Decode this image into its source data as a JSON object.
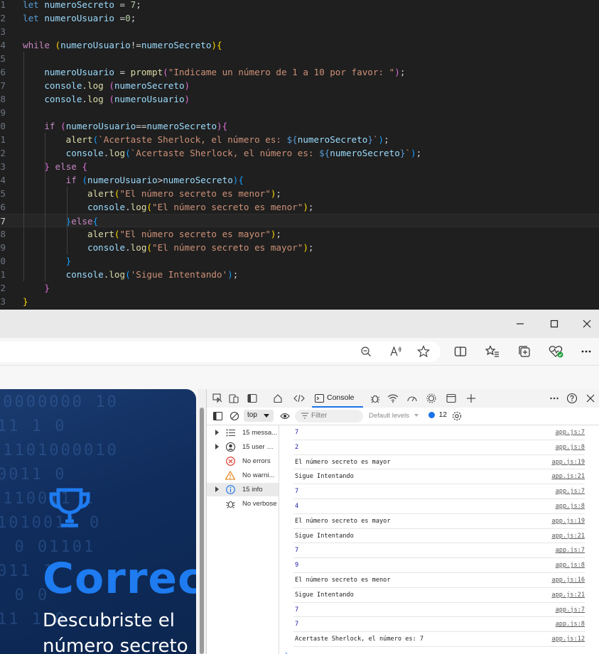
{
  "editor": {
    "lines": [
      {
        "n": "1",
        "tokens": [
          [
            "kw",
            "let"
          ],
          [
            "op",
            " "
          ],
          [
            "var",
            "numeroSecreto"
          ],
          [
            "op",
            " = "
          ],
          [
            "num",
            "7"
          ],
          [
            "op",
            ";"
          ]
        ]
      },
      {
        "n": "2",
        "tokens": [
          [
            "kw",
            "let"
          ],
          [
            "op",
            " "
          ],
          [
            "var",
            "numeroUsuario"
          ],
          [
            "op",
            " ="
          ],
          [
            "num",
            "0"
          ],
          [
            "op",
            ";"
          ]
        ]
      },
      {
        "n": "3",
        "tokens": []
      },
      {
        "n": "4",
        "tokens": [
          [
            "ctl",
            "while"
          ],
          [
            "op",
            " "
          ],
          [
            "b1",
            "("
          ],
          [
            "var",
            "numeroUsuario"
          ],
          [
            "op",
            "!="
          ],
          [
            "var",
            "numeroSecreto"
          ],
          [
            "b1",
            ")"
          ],
          [
            "b1",
            "{"
          ]
        ]
      },
      {
        "n": "5",
        "tokens": []
      },
      {
        "n": "6",
        "tokens": [
          [
            "op",
            "    "
          ],
          [
            "var",
            "numeroUsuario"
          ],
          [
            "op",
            " = "
          ],
          [
            "fn",
            "prompt"
          ],
          [
            "b2",
            "("
          ],
          [
            "str",
            "\"Indicame un número de 1 a 10 por favor: \""
          ],
          [
            "b2",
            ")"
          ],
          [
            "op",
            ";"
          ]
        ]
      },
      {
        "n": "7",
        "tokens": [
          [
            "op",
            "    "
          ],
          [
            "var",
            "console"
          ],
          [
            "op",
            "."
          ],
          [
            "fn",
            "log"
          ],
          [
            "op",
            " "
          ],
          [
            "b2",
            "("
          ],
          [
            "var",
            "numeroSecreto"
          ],
          [
            "b2",
            ")"
          ]
        ]
      },
      {
        "n": "8",
        "tokens": [
          [
            "op",
            "    "
          ],
          [
            "var",
            "console"
          ],
          [
            "op",
            "."
          ],
          [
            "fn",
            "log"
          ],
          [
            "op",
            " "
          ],
          [
            "b2",
            "("
          ],
          [
            "var",
            "numeroUsuario"
          ],
          [
            "b2",
            ")"
          ]
        ]
      },
      {
        "n": "9",
        "tokens": []
      },
      {
        "n": "0",
        "tokens": [
          [
            "op",
            "    "
          ],
          [
            "ctl",
            "if"
          ],
          [
            "op",
            " "
          ],
          [
            "b2",
            "("
          ],
          [
            "var",
            "numeroUsuario"
          ],
          [
            "op",
            "=="
          ],
          [
            "var",
            "numeroSecreto"
          ],
          [
            "b2",
            ")"
          ],
          [
            "b2",
            "{"
          ]
        ]
      },
      {
        "n": "1",
        "tokens": [
          [
            "op",
            "        "
          ],
          [
            "fn",
            "alert"
          ],
          [
            "b3",
            "("
          ],
          [
            "str",
            "`Acertaste Sherlock, el número es: "
          ],
          [
            "tpl",
            "${"
          ],
          [
            "var",
            "numeroSecreto"
          ],
          [
            "tpl",
            "}"
          ],
          [
            "str",
            "`"
          ],
          [
            "b3",
            ")"
          ],
          [
            "op",
            ";"
          ]
        ]
      },
      {
        "n": "2",
        "tokens": [
          [
            "op",
            "        "
          ],
          [
            "var",
            "console"
          ],
          [
            "op",
            "."
          ],
          [
            "fn",
            "log"
          ],
          [
            "b3",
            "("
          ],
          [
            "str",
            "`Acertaste Sherlock, el número es: "
          ],
          [
            "tpl",
            "${"
          ],
          [
            "var",
            "numeroSecreto"
          ],
          [
            "tpl",
            "}"
          ],
          [
            "str",
            "`"
          ],
          [
            "b3",
            ")"
          ],
          [
            "op",
            ";"
          ]
        ]
      },
      {
        "n": "3",
        "tokens": [
          [
            "op",
            "    "
          ],
          [
            "b2",
            "}"
          ],
          [
            "op",
            " "
          ],
          [
            "ctl",
            "else"
          ],
          [
            "op",
            " "
          ],
          [
            "b2",
            "{"
          ]
        ]
      },
      {
        "n": "4",
        "tokens": [
          [
            "op",
            "        "
          ],
          [
            "ctl",
            "if"
          ],
          [
            "op",
            " "
          ],
          [
            "b3",
            "("
          ],
          [
            "var",
            "numeroUsuario"
          ],
          [
            "op",
            ">"
          ],
          [
            "var",
            "numeroSecreto"
          ],
          [
            "b3",
            ")"
          ],
          [
            "b3",
            "{"
          ]
        ]
      },
      {
        "n": "5",
        "tokens": [
          [
            "op",
            "            "
          ],
          [
            "fn",
            "alert"
          ],
          [
            "b1",
            "("
          ],
          [
            "str",
            "\"El número secreto es menor\""
          ],
          [
            "b1",
            ")"
          ],
          [
            "op",
            ";"
          ]
        ]
      },
      {
        "n": "6",
        "tokens": [
          [
            "op",
            "            "
          ],
          [
            "var",
            "console"
          ],
          [
            "op",
            "."
          ],
          [
            "fn",
            "log"
          ],
          [
            "b1",
            "("
          ],
          [
            "str",
            "\"El número secreto es menor\""
          ],
          [
            "b1",
            ")"
          ],
          [
            "op",
            ";"
          ]
        ]
      },
      {
        "n": "7",
        "active": true,
        "tokens": [
          [
            "op",
            "        "
          ],
          [
            "b3",
            "}"
          ],
          [
            "ctl",
            "else"
          ],
          [
            "b3",
            "{"
          ]
        ]
      },
      {
        "n": "8",
        "tokens": [
          [
            "op",
            "            "
          ],
          [
            "fn",
            "alert"
          ],
          [
            "b1",
            "("
          ],
          [
            "str",
            "\"El número secreto es mayor\""
          ],
          [
            "b1",
            ")"
          ],
          [
            "op",
            ";"
          ]
        ]
      },
      {
        "n": "9",
        "tokens": [
          [
            "op",
            "            "
          ],
          [
            "var",
            "console"
          ],
          [
            "op",
            "."
          ],
          [
            "fn",
            "log"
          ],
          [
            "b1",
            "("
          ],
          [
            "str",
            "\"El número secreto es mayor\""
          ],
          [
            "b1",
            ")"
          ],
          [
            "op",
            ";"
          ]
        ]
      },
      {
        "n": "0",
        "tokens": [
          [
            "op",
            "        "
          ],
          [
            "b3",
            "}"
          ]
        ]
      },
      {
        "n": "1",
        "tokens": [
          [
            "op",
            "        "
          ],
          [
            "var",
            "console"
          ],
          [
            "op",
            "."
          ],
          [
            "fn",
            "log"
          ],
          [
            "b3",
            "("
          ],
          [
            "str",
            "'Sigue Intentando'"
          ],
          [
            "b3",
            ")"
          ],
          [
            "op",
            ";"
          ]
        ]
      },
      {
        "n": "2",
        "tokens": [
          [
            "op",
            "    "
          ],
          [
            "b2",
            "}"
          ]
        ]
      },
      {
        "n": "3",
        "tokens": [
          [
            "b1",
            "}"
          ]
        ]
      }
    ]
  },
  "browser": {
    "window_controls": [
      "minimize-icon",
      "maximize-icon",
      "close-icon"
    ],
    "toolbar_icons": [
      "zoom-out-icon",
      "read-aloud-icon",
      "favorite-star-icon",
      "split-screen-icon",
      "favorites-list-icon",
      "collections-icon",
      "browser-essentials-icon",
      "more-menu-icon"
    ]
  },
  "page": {
    "title": "Correct",
    "message": "Descubriste el número secreto",
    "bg_digits": [
      "00000000 10",
      "11 1 0",
      "11101000010",
      "0011 0",
      "0110011 1",
      "1010011 0",
      "1 0 01101",
      "011 1",
      "1 0 0",
      "11 1 0"
    ]
  },
  "devtools": {
    "tabs": {
      "console": "Console"
    },
    "toolbar": {
      "context": "top",
      "filter_placeholder": "Filter",
      "levels": "Default levels",
      "issues_count": "12"
    },
    "sidebar": [
      {
        "label": "15 messa...",
        "icon": "list-icon",
        "expandable": true
      },
      {
        "label": "15 user m...",
        "icon": "user-icon",
        "expandable": true
      },
      {
        "label": "No errors",
        "icon": "error-icon",
        "expandable": false
      },
      {
        "label": "No warni...",
        "icon": "warning-icon",
        "expandable": false
      },
      {
        "label": "15 info",
        "icon": "info-icon",
        "expandable": true,
        "selected": true
      },
      {
        "label": "No verbose",
        "icon": "bug-icon",
        "expandable": false
      }
    ],
    "logs": [
      {
        "msg": "7",
        "src": "app.js:7",
        "num": true
      },
      {
        "msg": "2",
        "src": "app.js:8",
        "num": true
      },
      {
        "msg": "El número secreto es mayor",
        "src": "app.js:19"
      },
      {
        "msg": "Sigue Intentando",
        "src": "app.js:21"
      },
      {
        "msg": "7",
        "src": "app.js:7",
        "num": true
      },
      {
        "msg": "4",
        "src": "app.js:8",
        "num": true
      },
      {
        "msg": "El número secreto es mayor",
        "src": "app.js:19"
      },
      {
        "msg": "Sigue Intentando",
        "src": "app.js:21"
      },
      {
        "msg": "7",
        "src": "app.js:7",
        "num": true
      },
      {
        "msg": "9",
        "src": "app.js:8",
        "num": true
      },
      {
        "msg": "El número secreto es menor",
        "src": "app.js:16"
      },
      {
        "msg": "Sigue Intentando",
        "src": "app.js:21"
      },
      {
        "msg": "7",
        "src": "app.js:7",
        "num": true
      },
      {
        "msg": "7",
        "src": "app.js:8",
        "num": true
      },
      {
        "msg": "Acertaste Sherlock, el número es: 7",
        "src": "app.js:12"
      }
    ],
    "prompt": "›"
  }
}
